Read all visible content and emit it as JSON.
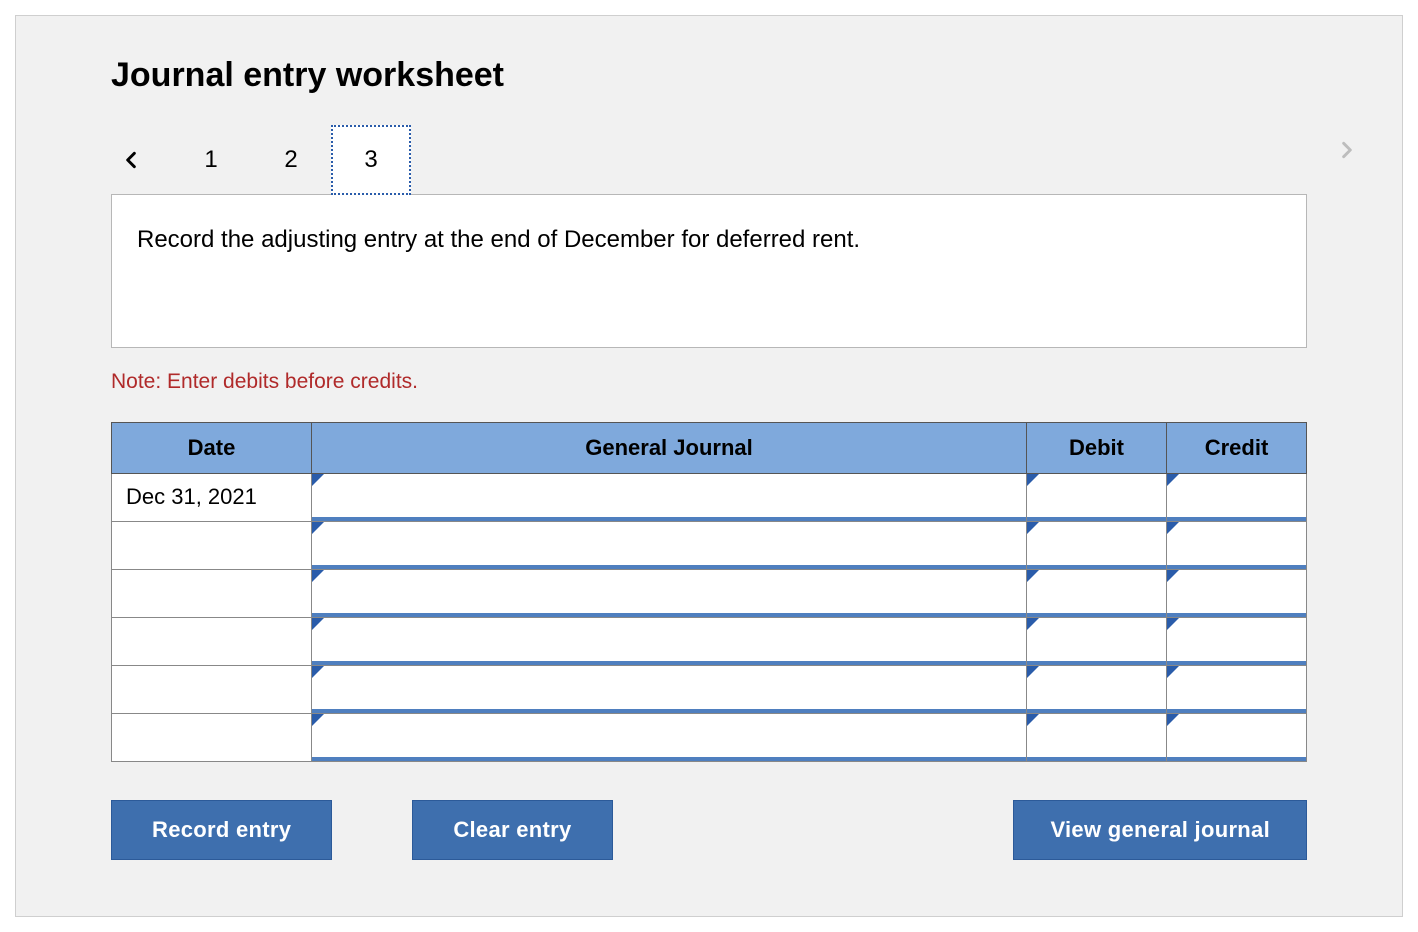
{
  "title": "Journal entry worksheet",
  "tabs": {
    "items": [
      "1",
      "2",
      "3"
    ],
    "active_index": 2
  },
  "instruction": "Record the adjusting entry at the end of December for deferred rent.",
  "note": "Note: Enter debits before credits.",
  "table": {
    "headers": {
      "date": "Date",
      "gj": "General Journal",
      "debit": "Debit",
      "credit": "Credit"
    },
    "rows": [
      {
        "date": "Dec 31, 2021",
        "gj": "",
        "debit": "",
        "credit": ""
      },
      {
        "date": "",
        "gj": "",
        "debit": "",
        "credit": ""
      },
      {
        "date": "",
        "gj": "",
        "debit": "",
        "credit": ""
      },
      {
        "date": "",
        "gj": "",
        "debit": "",
        "credit": ""
      },
      {
        "date": "",
        "gj": "",
        "debit": "",
        "credit": ""
      },
      {
        "date": "",
        "gj": "",
        "debit": "",
        "credit": ""
      }
    ]
  },
  "buttons": {
    "record": "Record entry",
    "clear": "Clear entry",
    "view": "View general journal"
  }
}
